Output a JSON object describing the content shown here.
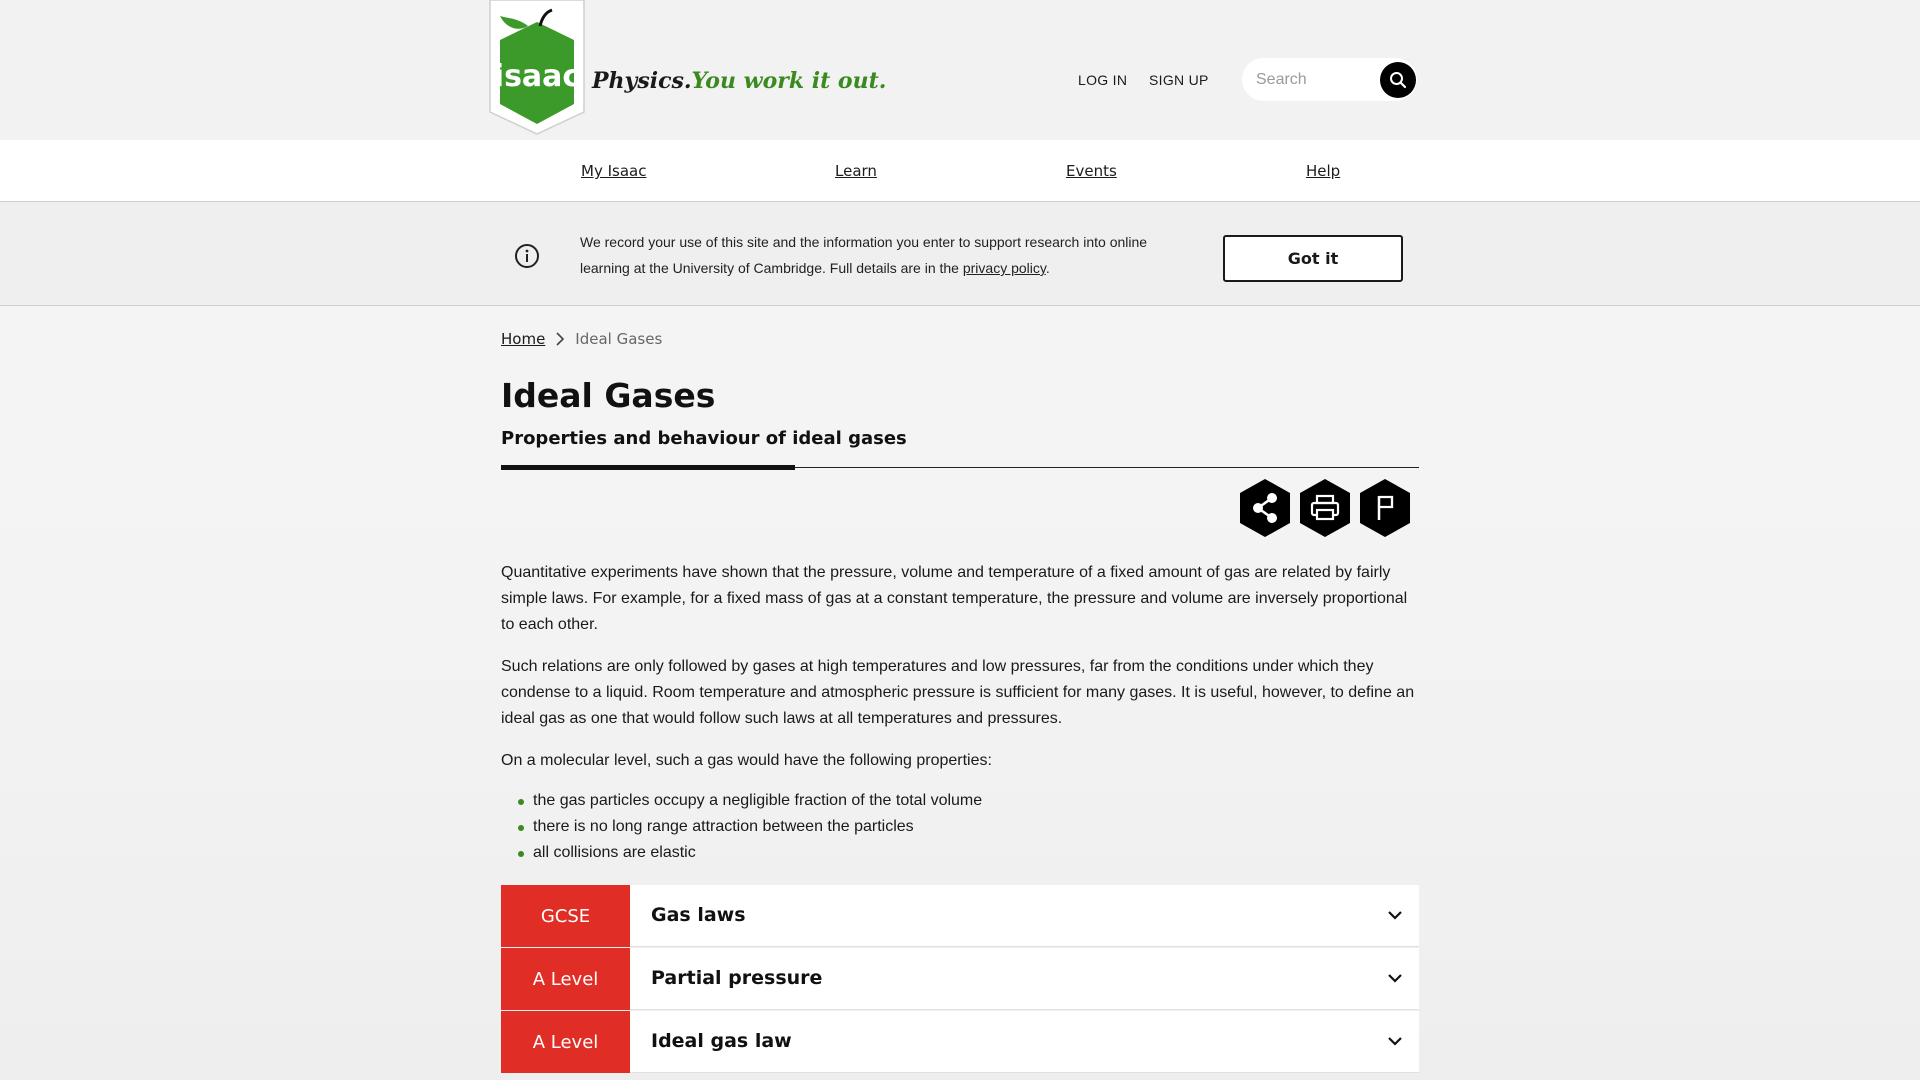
{
  "header": {
    "logo_text": "isaac",
    "tagline_a": "Physics.",
    "tagline_b": "You work it out.",
    "login_label": "LOG IN",
    "signup_label": "SIGN UP",
    "search_placeholder": "Search"
  },
  "nav": {
    "items": [
      {
        "label": "My Isaac"
      },
      {
        "label": "Learn"
      },
      {
        "label": "Events"
      },
      {
        "label": "Help"
      }
    ]
  },
  "banner": {
    "text_before": "We record your use of this site and the information you enter to support research into online learning at the University of Cambridge. Full details are in the ",
    "link_text": "privacy policy",
    "text_after": ".",
    "button_label": "Got it"
  },
  "breadcrumb": {
    "home": "Home",
    "current": "Ideal Gases"
  },
  "page": {
    "title": "Ideal Gases",
    "subtitle": "Properties and behaviour of ideal gases"
  },
  "content": {
    "paragraphs": [
      "Quantitative experiments have shown that the pressure, volume and temperature of a fixed amount of gas are related by fairly simple laws. For example, for a fixed mass of gas at a constant temperature, the pressure and volume are inversely proportional to each other.",
      "Such relations are only followed by gases at high temperatures and low pressures, far from the conditions under which they condense to a liquid. Room temperature and atmospheric pressure is sufficient for many gases. It is useful, however, to define an ideal gas as one that would follow such laws at all temperatures and pressures.",
      "On a molecular level, such a gas would have the following properties:"
    ],
    "bullets": [
      "the gas particles occupy a negligible fraction of the total volume",
      "there is no long range attraction between the particles",
      "all collisions are elastic"
    ]
  },
  "accordions": [
    {
      "level": "GCSE",
      "title": "Gas laws"
    },
    {
      "level": "A Level",
      "title": "Partial pressure"
    },
    {
      "level": "A Level",
      "title": "Ideal gas law"
    }
  ],
  "colors": {
    "accent_green": "#3a8a1f",
    "level_red": "#e02d25"
  },
  "icons": {
    "share": "share-icon",
    "print": "print-icon",
    "report": "flag-icon",
    "search": "search-icon",
    "info": "info-icon",
    "chevron": "chevron-down-icon"
  }
}
